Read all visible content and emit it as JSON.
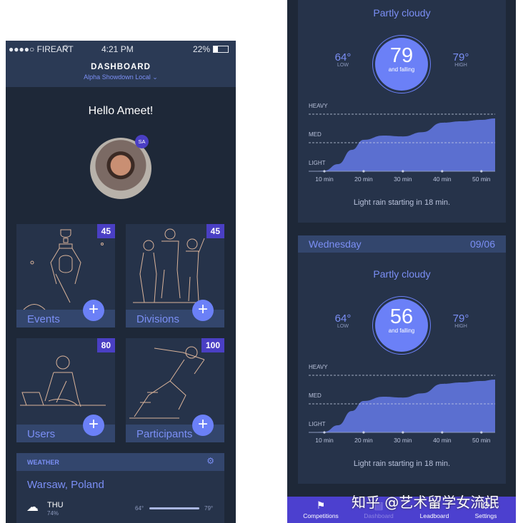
{
  "status": {
    "carrier": "●●●●○ FIREART",
    "time": "4:21 PM",
    "battery": "22%"
  },
  "header": {
    "title": "DASHBOARD",
    "subtitle": "Alpha Showdown Local"
  },
  "greeting": "Hello Ameet!",
  "avatar": {
    "initials": "SA"
  },
  "tiles": [
    {
      "label": "Events",
      "count": "45"
    },
    {
      "label": "Divisions",
      "count": "45"
    },
    {
      "label": "Users",
      "count": "80"
    },
    {
      "label": "Participants",
      "count": "100"
    }
  ],
  "weather_widget": {
    "title": "WEATHER",
    "city": "Warsaw, Poland",
    "day": "THU",
    "humidity": "74%",
    "low": "64°",
    "high": "79°"
  },
  "forecast_cards": [
    {
      "condition": "Partly cloudy",
      "low": "64°",
      "low_label": "LOW",
      "high": "79°",
      "high_label": "HIGH",
      "current": "79",
      "trend": "and falling",
      "summary": "Light rain starting in 18 min."
    },
    {
      "day": "Wednesday",
      "date": "09/06",
      "condition": "Partly cloudy",
      "low": "64°",
      "low_label": "LOW",
      "high": "79°",
      "high_label": "HIGH",
      "current": "56",
      "trend": "and falling",
      "summary": "Light rain starting in 18 min."
    }
  ],
  "chart_data": {
    "type": "area",
    "levels": [
      "LIGHT",
      "MED",
      "HEAVY"
    ],
    "x_ticks": [
      "10 min",
      "20 min",
      "30 min",
      "40 min",
      "50 min"
    ],
    "tick_values": [
      10,
      20,
      30,
      40,
      50
    ],
    "xlim": [
      6,
      53.5
    ],
    "ylim": [
      0,
      2
    ],
    "x": [
      6,
      10,
      13.5,
      17,
      20,
      25,
      30,
      35,
      40,
      45,
      50,
      53.5
    ],
    "y": [
      0,
      0.02,
      0.25,
      0.75,
      1.1,
      1.25,
      1.22,
      1.37,
      1.7,
      1.75,
      1.8,
      1.85
    ],
    "fill": "#5b6fd0"
  },
  "tabbar": {
    "items": [
      "Competitions",
      "Dashboard",
      "Leadboard",
      "Settings"
    ],
    "active": "Dashboard"
  },
  "watermark": "知乎 @艺术留学女流氓",
  "colors": {
    "accent": "#7b8ff5",
    "badge": "#4a3fc4",
    "tabbar": "#4c40cf",
    "background": "#1e2838"
  }
}
